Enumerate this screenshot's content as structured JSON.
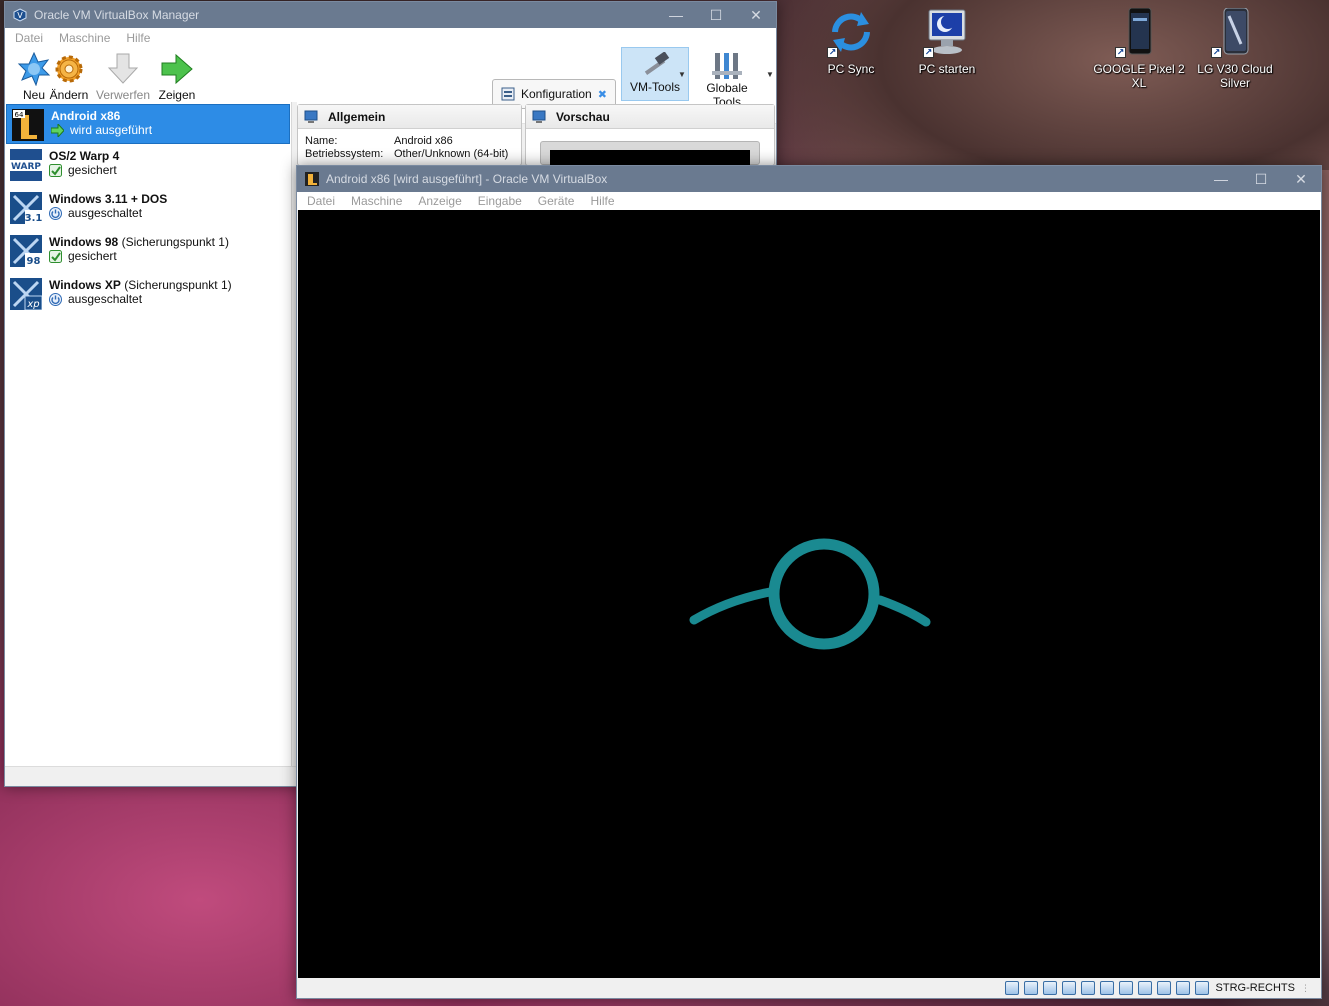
{
  "desktop": {
    "icons": [
      {
        "label": "PC Sync"
      },
      {
        "label": "PC starten"
      },
      {
        "label": "GOOGLE Pixel 2 XL"
      },
      {
        "label": "LG V30 Cloud Silver"
      }
    ]
  },
  "manager": {
    "title": "Oracle VM VirtualBox Manager",
    "menu": [
      "Datei",
      "Maschine",
      "Hilfe"
    ],
    "toolbar": {
      "new_label": "Neu",
      "change_label": "Ändern",
      "discard_label": "Verwerfen",
      "show_label": "Zeigen",
      "config_label": "Konfiguration",
      "vmtools_label": "VM-Tools",
      "globaltools_label": "Globale Tools"
    },
    "vms": [
      {
        "name": "Android x86",
        "snapshot": "",
        "state": "wird ausgeführt",
        "os_badge": "64"
      },
      {
        "name": "OS/2 Warp 4",
        "snapshot": "",
        "state": "gesichert",
        "os_badge": "WARP"
      },
      {
        "name": "Windows 3.11 + DOS",
        "snapshot": "",
        "state": "ausgeschaltet",
        "os_badge": "3.1"
      },
      {
        "name": "Windows 98",
        "snapshot": "(Sicherungspunkt 1)",
        "state": "gesichert",
        "os_badge": "98"
      },
      {
        "name": "Windows XP",
        "snapshot": "(Sicherungspunkt 1)",
        "state": "ausgeschaltet",
        "os_badge": "xp"
      }
    ],
    "general": {
      "title": "Allgemein",
      "name_key": "Name:",
      "name_val": "Android x86",
      "os_key": "Betriebssystem:",
      "os_val": "Other/Unknown (64-bit)"
    },
    "preview": {
      "title": "Vorschau"
    }
  },
  "vm_window": {
    "title": "Android x86 [wird ausgeführt] - Oracle VM VirtualBox",
    "menu": [
      "Datei",
      "Maschine",
      "Anzeige",
      "Eingabe",
      "Geräte",
      "Hilfe"
    ],
    "host_key": "STRG-RECHTS",
    "boot_logo_color": "#1a8a91"
  },
  "colors": {
    "selection": "#2d8ce6",
    "running_green": "#2fa02f"
  }
}
